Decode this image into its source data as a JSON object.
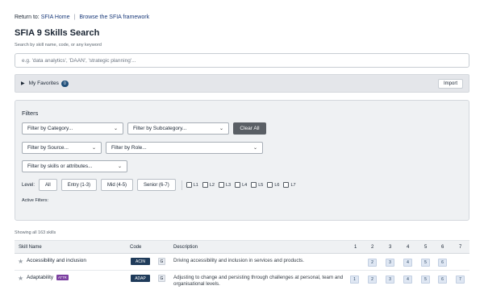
{
  "nav": {
    "return_label": "Return to:",
    "home_link": "SFIA Home",
    "separator": "|",
    "framework_link": "Browse the SFIA framework"
  },
  "page": {
    "title": "SFIA 9 Skills Search",
    "subtitle": "Search by skill name, code, or any keyword"
  },
  "search": {
    "placeholder": "e.g. 'data analytics', 'DAAN', 'strategic planning'..."
  },
  "favorites": {
    "label": "My Favorites",
    "count": "0",
    "import_label": "Import"
  },
  "filters": {
    "title": "Filters",
    "category": "Filter by Category...",
    "subcategory": "Filter by Subcategory...",
    "clear_label": "Clear All",
    "source": "Filter by Source...",
    "role": "Filter by Role...",
    "skills_attributes": "Filter by skills or attributes...",
    "level_label": "Level:",
    "level_buttons": [
      "All",
      "Entry (1-3)",
      "Mid (4-5)",
      "Senior (6-7)"
    ],
    "level_checks": [
      "L1",
      "L2",
      "L3",
      "L4",
      "L5",
      "L6",
      "L7"
    ],
    "active_label": "Active Filters:"
  },
  "results": {
    "showing": "Showing all 163 skills",
    "columns": {
      "skill_name": "Skill Name",
      "code": "Code",
      "description": "Description",
      "levels": [
        "1",
        "2",
        "3",
        "4",
        "5",
        "6",
        "7"
      ]
    },
    "rows": [
      {
        "name": "Accessibility and inclusion",
        "attr": "",
        "code": "ACIN",
        "category": "G",
        "description": "Driving accessibility and inclusion in services and products.",
        "levels": [
          "",
          "2",
          "3",
          "4",
          "5",
          "6",
          ""
        ]
      },
      {
        "name": "Adaptability",
        "attr": "ATTR",
        "code": "ADAP",
        "category": "G",
        "description": "Adjusting to change and persisting through challenges at personal, team and organisational levels.",
        "levels": [
          "1",
          "2",
          "3",
          "4",
          "5",
          "6",
          "7"
        ]
      }
    ]
  },
  "colors": {
    "code_badge": "#1f3b5a",
    "attr_badge": "#7b3fa0",
    "clear_button": "#5a5f65",
    "favorites_badge": "#1f4e79"
  }
}
